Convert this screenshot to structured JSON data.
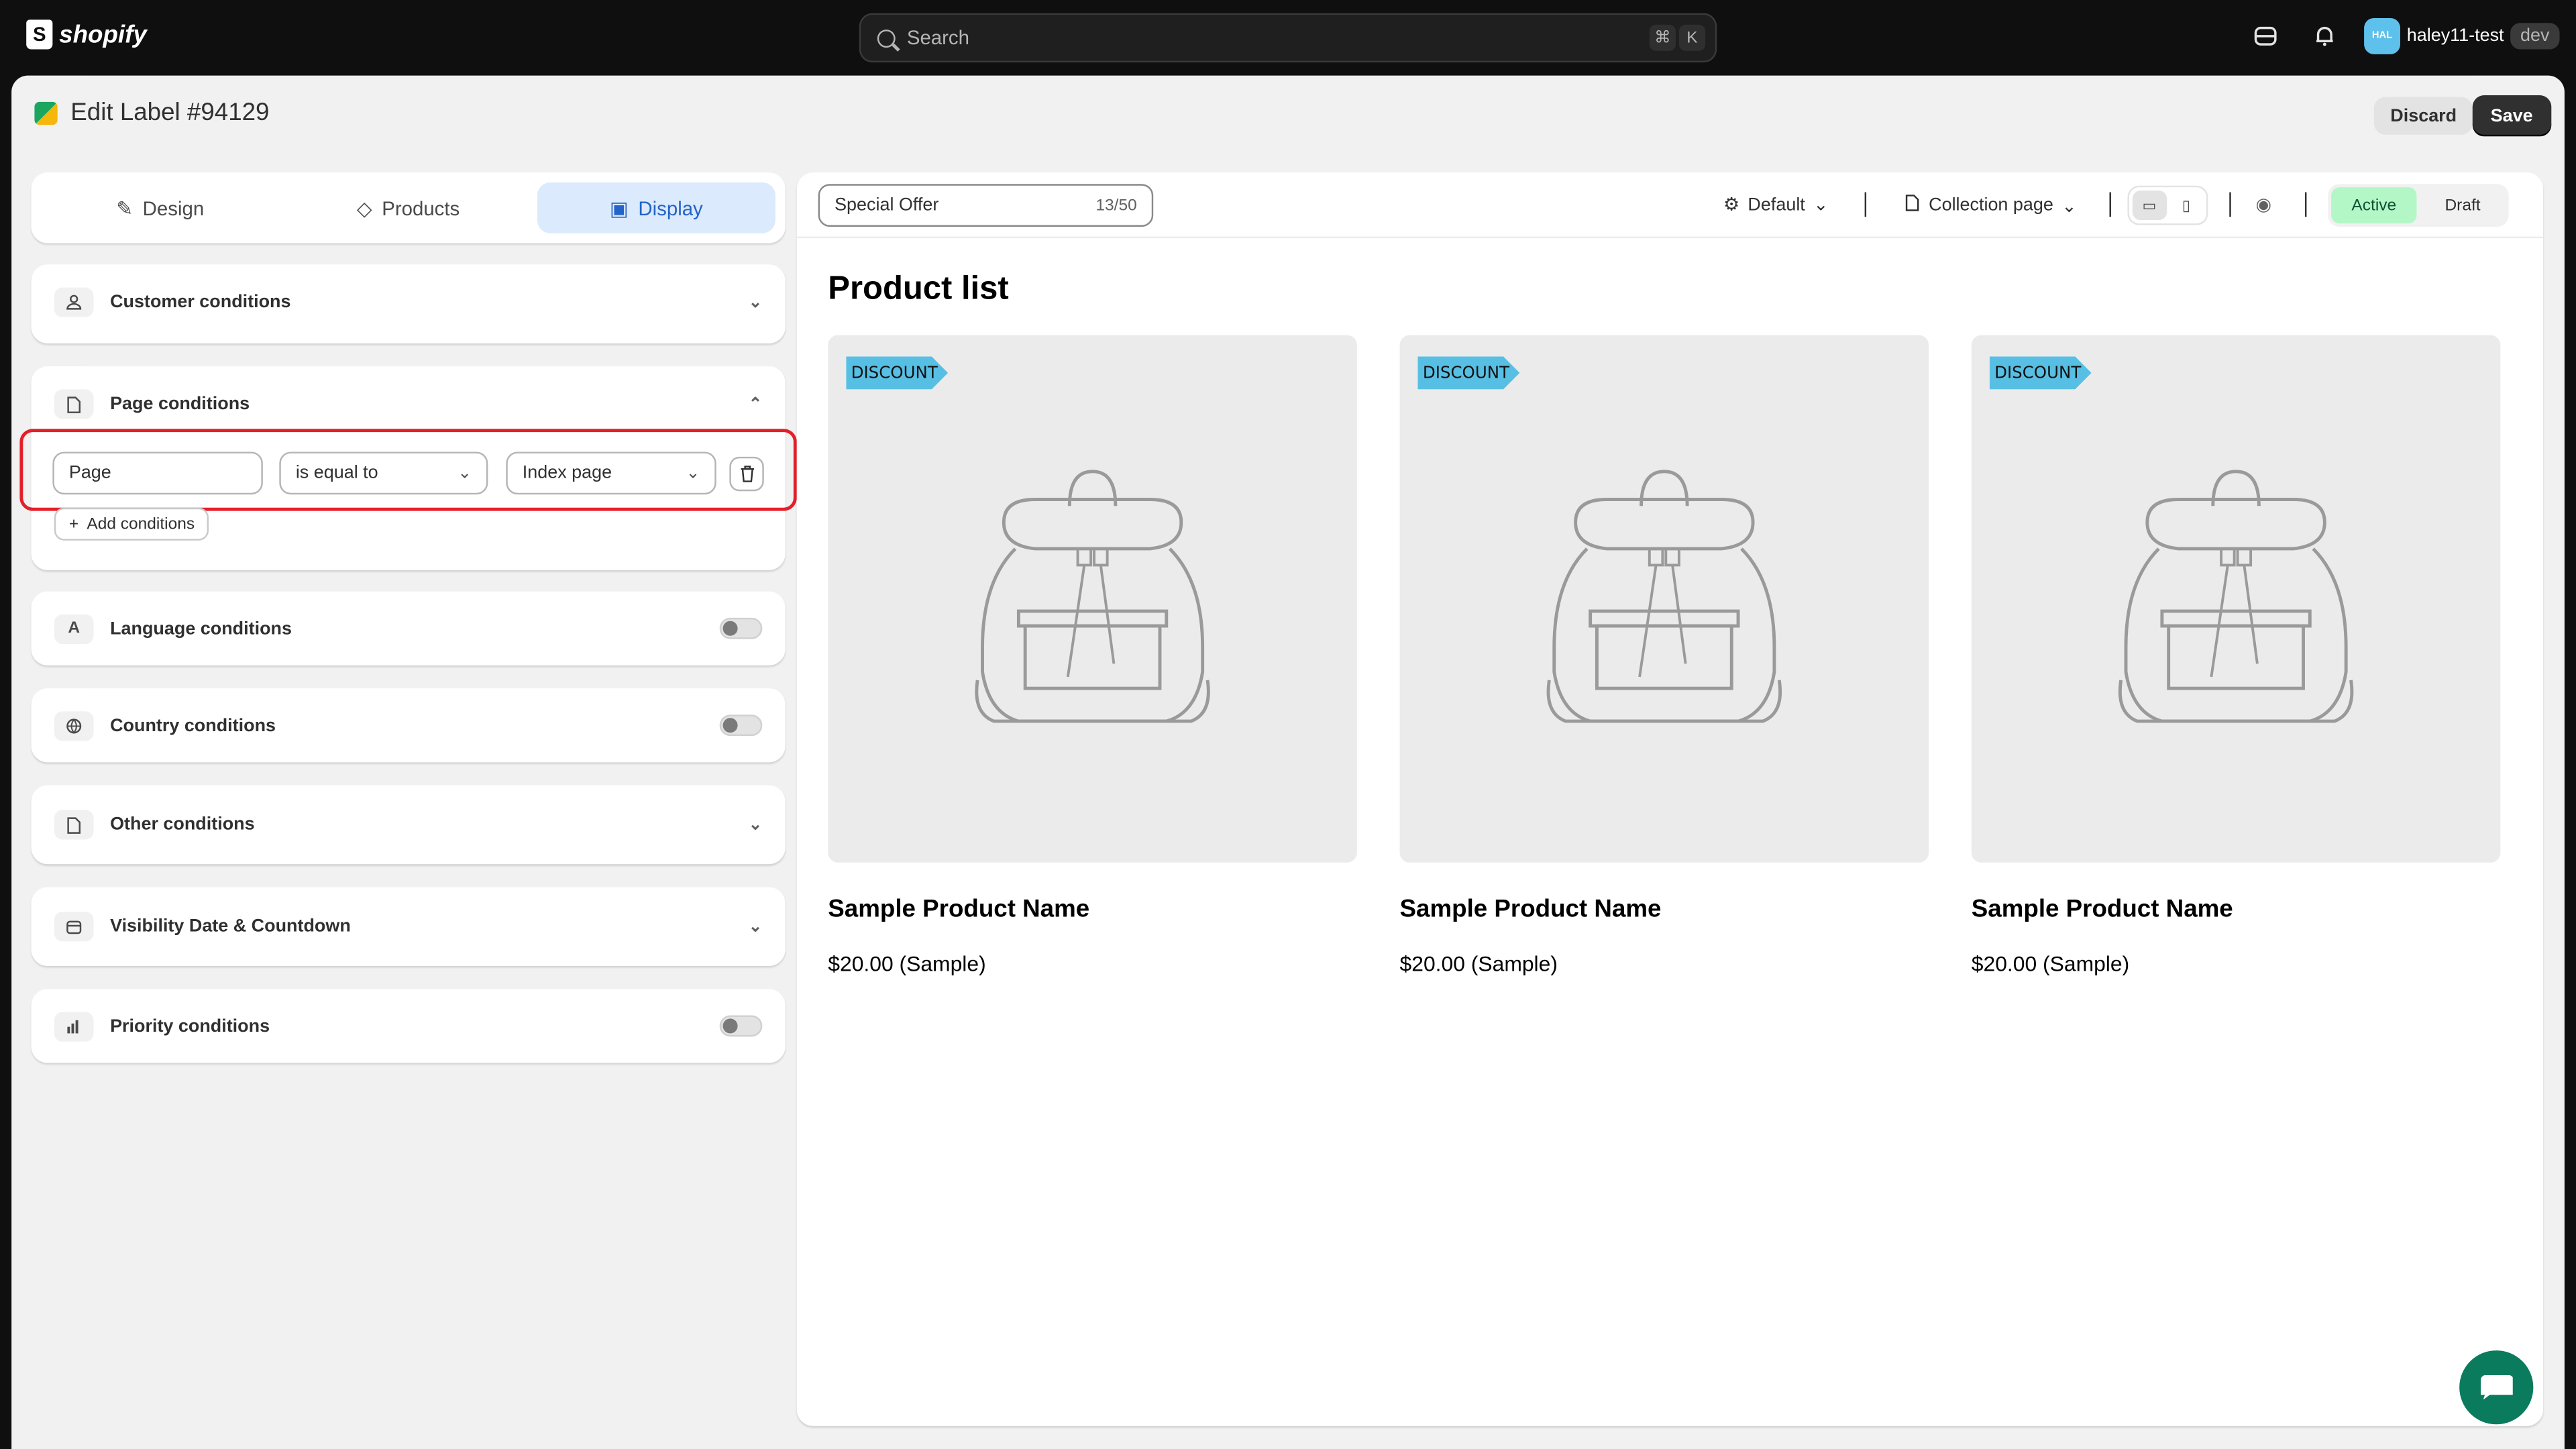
{
  "topbar": {
    "brand": "shopify",
    "search_placeholder": "Search",
    "shortcut_cmd": "⌘",
    "shortcut_key": "K",
    "avatar_initials": "HAL",
    "store_name": "haley11-test",
    "env_tag": "dev"
  },
  "header": {
    "title": "Edit Label #94129",
    "discard_label": "Discard",
    "save_label": "Save"
  },
  "tabs": [
    {
      "label": "Design",
      "icon": "magic-wand-icon",
      "active": false
    },
    {
      "label": "Products",
      "icon": "tag-icon",
      "active": false
    },
    {
      "label": "Display",
      "icon": "image-icon",
      "active": true
    }
  ],
  "conditions": {
    "customer": {
      "label": "Customer conditions",
      "icon": "person-icon"
    },
    "page": {
      "label": "Page conditions",
      "icon": "page-icon",
      "field": "Page",
      "operator": "is equal to",
      "value": "Index page",
      "add_label": "Add conditions"
    },
    "language": {
      "label": "Language conditions",
      "icon": "language-icon",
      "enabled": false
    },
    "country": {
      "label": "Country conditions",
      "icon": "globe-icon",
      "enabled": false
    },
    "other": {
      "label": "Other conditions",
      "icon": "document-icon"
    },
    "visibility": {
      "label": "Visibility Date & Countdown",
      "icon": "calendar-icon"
    },
    "priority": {
      "label": "Priority conditions",
      "icon": "bar-chart-icon",
      "enabled": false
    }
  },
  "preview": {
    "label_text": "Special Offer",
    "label_count": "13/50",
    "theme_select": "Default",
    "page_select": "Collection page",
    "status_active": "Active",
    "status_draft": "Draft",
    "list_title": "Product list",
    "badge_text": "DISCOUNT",
    "products": [
      {
        "name": "Sample Product Name",
        "price": "$20.00 (Sample)"
      },
      {
        "name": "Sample Product Name",
        "price": "$20.00 (Sample)"
      },
      {
        "name": "Sample Product Name",
        "price": "$20.00 (Sample)"
      }
    ]
  },
  "colors": {
    "accent_tab": "#dbeafc",
    "active_status": "#b4f7c7",
    "badge": "#58bfe4",
    "highlight_border": "#e3202a",
    "chat_button": "#0a7b5c"
  }
}
